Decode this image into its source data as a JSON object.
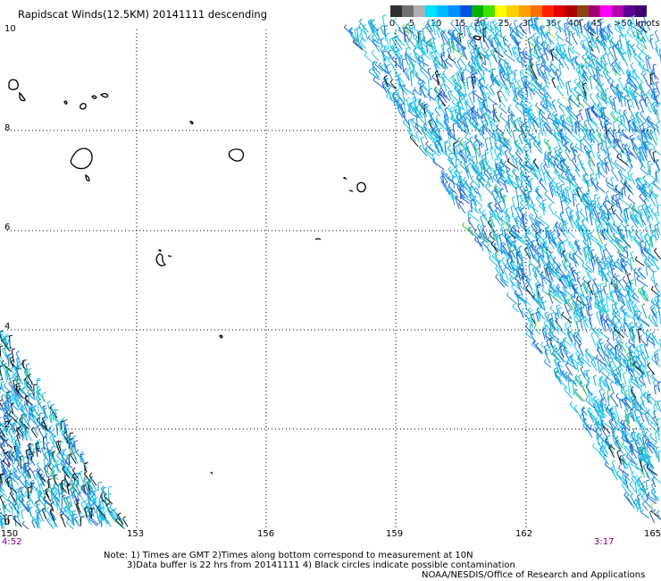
{
  "header": {
    "title": "Rapidscat Winds(12.5KM) 20141111 descending"
  },
  "scale": {
    "labels": [
      "0",
      "5",
      "10",
      "15",
      "20",
      "25",
      "30",
      "35",
      "40",
      "45",
      ">50 knots"
    ],
    "colors": [
      "#303030",
      "#707070",
      "#b0b0b0",
      "#00e0ff",
      "#00b8ff",
      "#0090ff",
      "#0050e0",
      "#00b000",
      "#40e000",
      "#ffff00",
      "#ffd000",
      "#ffa000",
      "#ff7000",
      "#ff2000",
      "#e00000",
      "#b00000",
      "#8b4513",
      "#a00070",
      "#ff00ff",
      "#b000b0",
      "#600090",
      "#400070"
    ]
  },
  "map": {
    "y_labels": [
      "10",
      "8",
      "6",
      "4",
      "2",
      "0"
    ],
    "x_labels": [
      "150",
      "153",
      "156",
      "159",
      "162",
      "165"
    ],
    "time_left": "4:52",
    "time_right": "3:17",
    "gridline_color": "#000000",
    "swath_colors": [
      "#22b8e8",
      "#16c8e0",
      "#1e8ee0",
      "#2a5ad8",
      "#1aa0c0",
      "#1bd0ff"
    ]
  },
  "notes": {
    "line1": "Note: 1) Times are GMT 2)Times along bottom correspond to measurement at 10N",
    "line2": "3)Data buffer is 22 hrs from 20141111 4) Black circles indicate possible contamination",
    "line3": "NOAA/NESDIS/Office of Research and Applications"
  }
}
